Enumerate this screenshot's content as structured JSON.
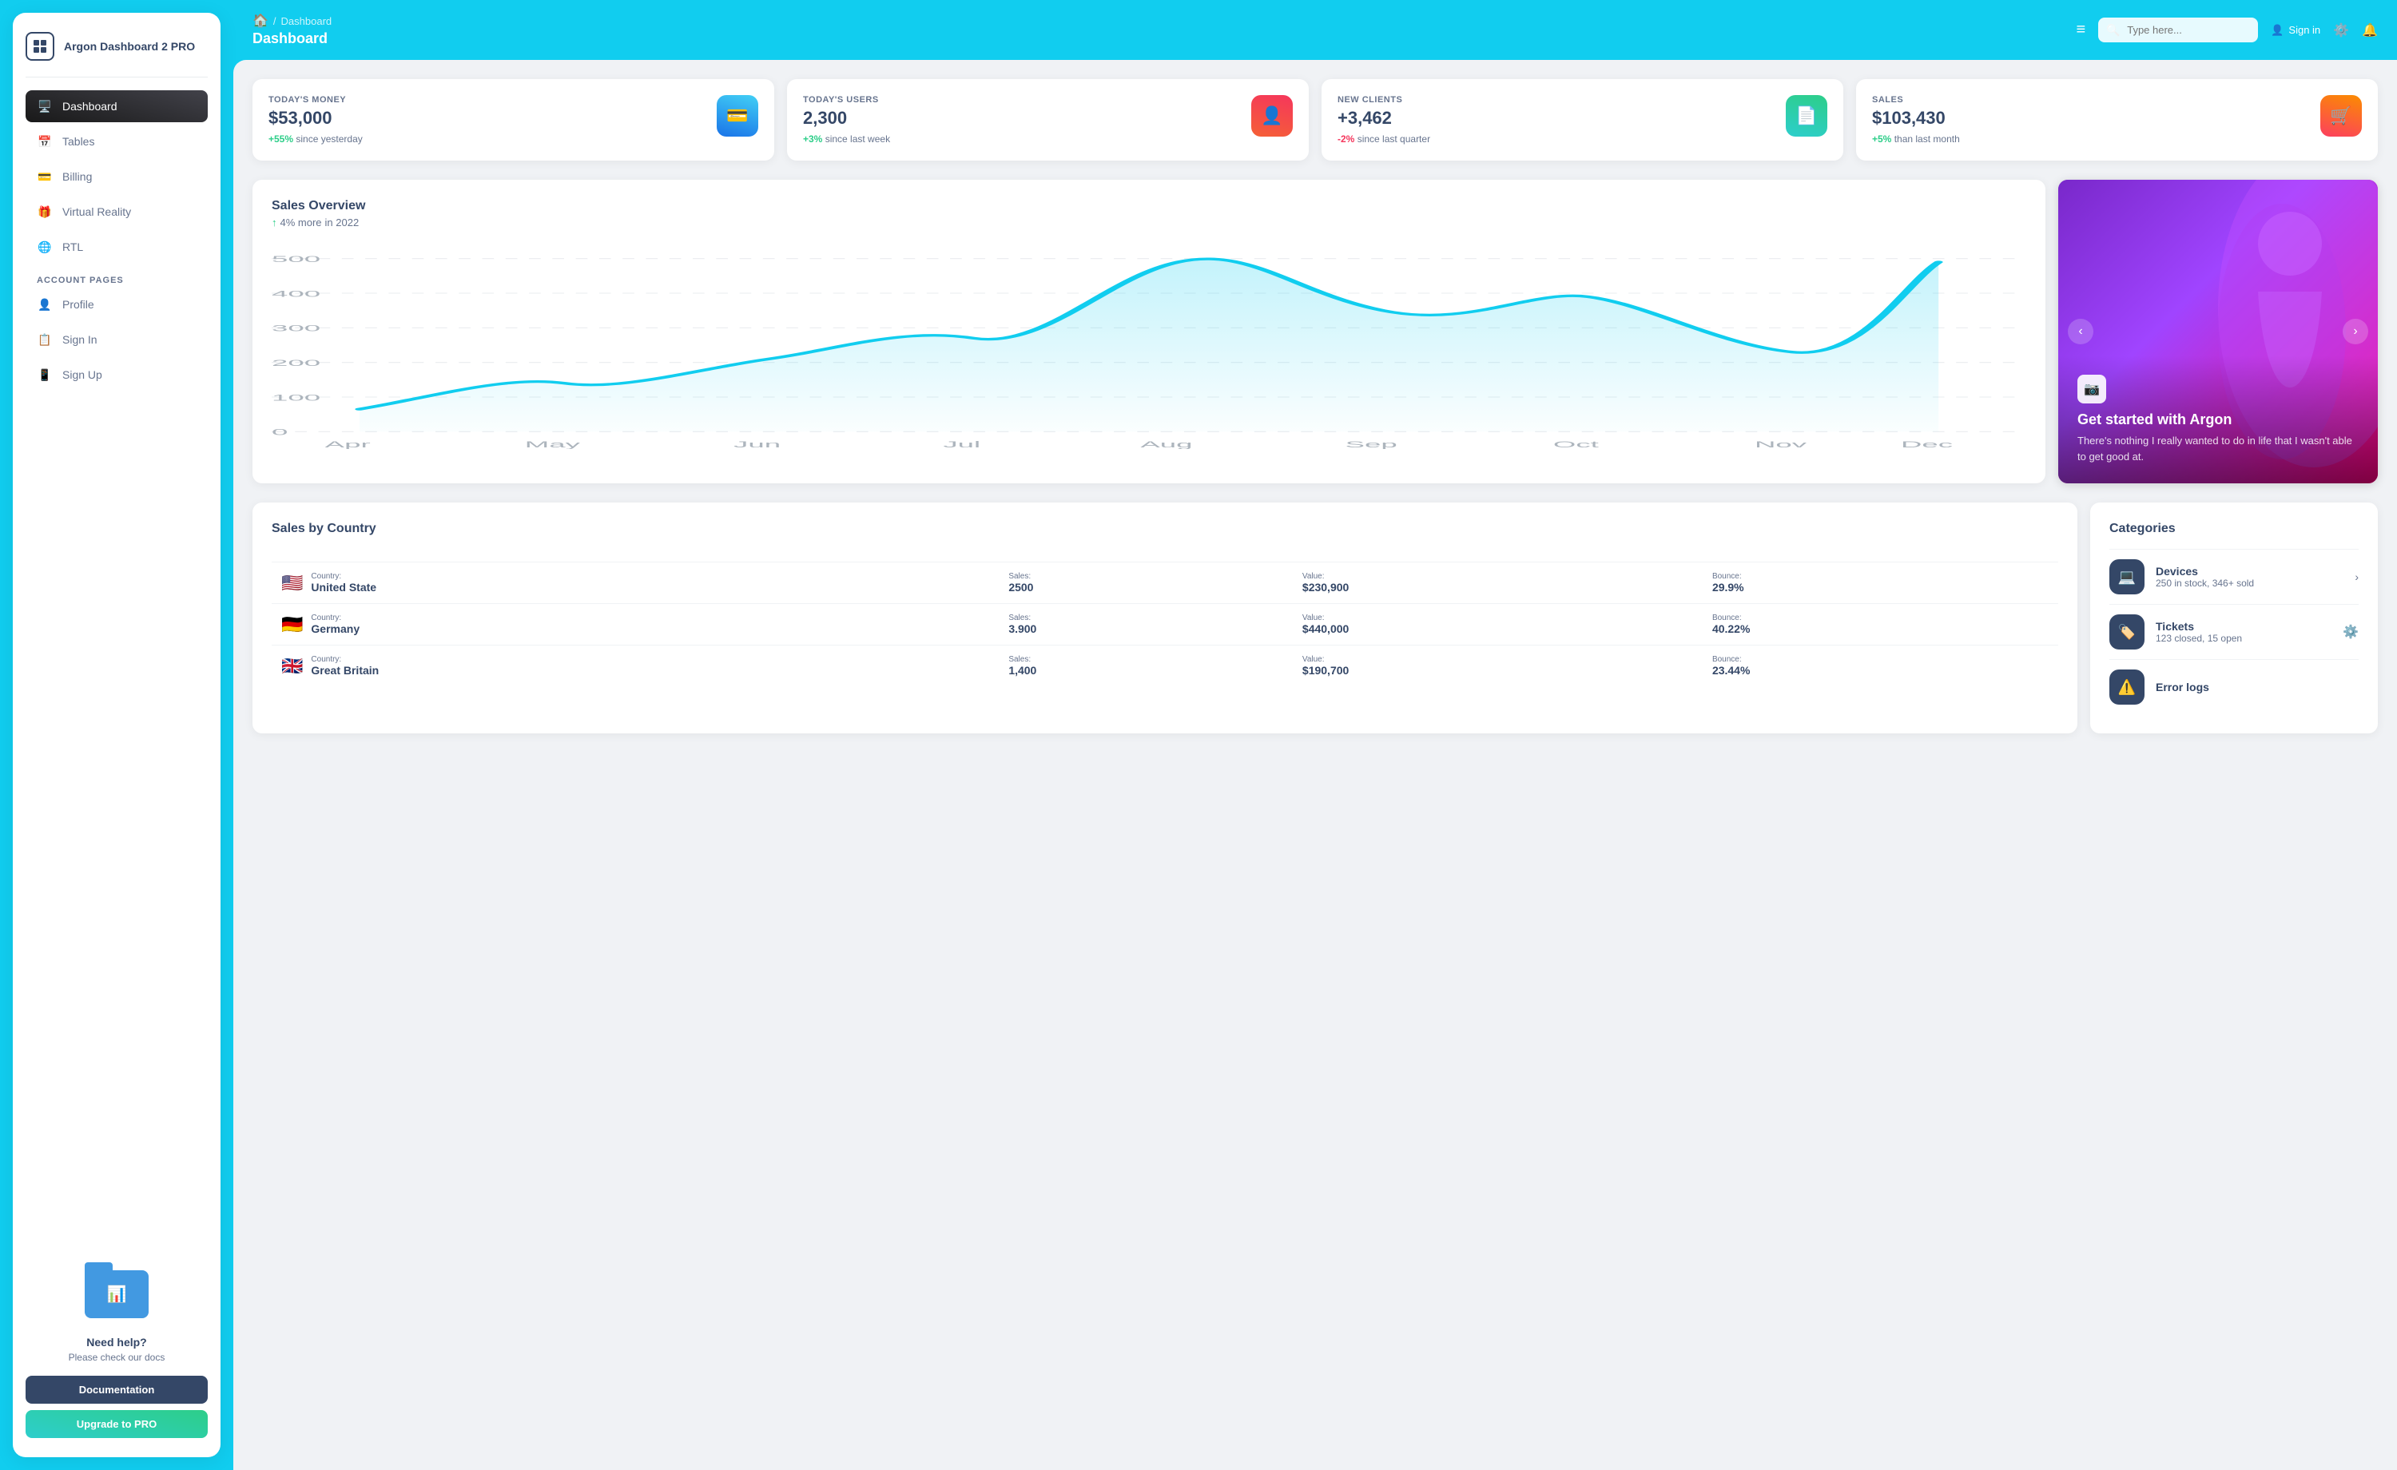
{
  "sidebar": {
    "logo_text": "Argon Dashboard 2 PRO",
    "nav_items": [
      {
        "id": "dashboard",
        "label": "Dashboard",
        "active": true,
        "icon": "🖥️"
      },
      {
        "id": "tables",
        "label": "Tables",
        "active": false,
        "icon": "📅"
      },
      {
        "id": "billing",
        "label": "Billing",
        "active": false,
        "icon": "💳"
      },
      {
        "id": "virtual-reality",
        "label": "Virtual Reality",
        "active": false,
        "icon": "🎁"
      },
      {
        "id": "rtl",
        "label": "RTL",
        "active": false,
        "icon": "🌐"
      }
    ],
    "account_section_label": "ACCOUNT PAGES",
    "account_items": [
      {
        "id": "profile",
        "label": "Profile",
        "icon": "👤"
      },
      {
        "id": "sign-in",
        "label": "Sign In",
        "icon": "📋"
      },
      {
        "id": "sign-up",
        "label": "Sign Up",
        "icon": "📱"
      }
    ],
    "help": {
      "title": "Need help?",
      "subtitle": "Please check our docs",
      "btn_docs": "Documentation",
      "btn_upgrade": "Upgrade to PRO"
    }
  },
  "header": {
    "breadcrumb_home": "🏠",
    "breadcrumb_sep": "/",
    "breadcrumb_page": "Dashboard",
    "title": "Dashboard",
    "menu_icon": "≡",
    "search_placeholder": "Type here...",
    "sign_in": "Sign in"
  },
  "stat_cards": [
    {
      "label": "TODAY'S MONEY",
      "value": "$53,000",
      "change_highlight": "+55%",
      "change_suffix": "since yesterday",
      "change_type": "pos",
      "icon": "💳",
      "icon_class": "stat-icon-blue"
    },
    {
      "label": "TODAY'S USERS",
      "value": "2,300",
      "change_highlight": "+3%",
      "change_suffix": "since last week",
      "change_type": "pos",
      "icon": "👤",
      "icon_class": "stat-icon-red"
    },
    {
      "label": "NEW CLIENTS",
      "value": "+3,462",
      "change_highlight": "-2%",
      "change_suffix": "since last quarter",
      "change_type": "neg",
      "icon": "📄",
      "icon_class": "stat-icon-green"
    },
    {
      "label": "SALES",
      "value": "$103,430",
      "change_highlight": "+5%",
      "change_suffix": "than last month",
      "change_type": "pos",
      "icon": "🛒",
      "icon_class": "stat-icon-orange"
    }
  ],
  "chart": {
    "title": "Sales Overview",
    "subtitle_highlight": "4% more",
    "subtitle_rest": "in 2022",
    "x_labels": [
      "Apr",
      "May",
      "Jun",
      "Jul",
      "Aug",
      "Sep",
      "Oct",
      "Nov",
      "Dec"
    ],
    "y_labels": [
      "500",
      "400",
      "300",
      "200",
      "100",
      "0"
    ],
    "data_points": [
      65,
      140,
      210,
      270,
      490,
      350,
      390,
      230,
      490
    ]
  },
  "promo": {
    "title": "Get started with Argon",
    "description": "There's nothing I really wanted to do in life that I wasn't able to get good at.",
    "icon": "📷"
  },
  "sales_by_country": {
    "title": "Sales by Country",
    "col_country": "Country:",
    "col_sales": "Sales:",
    "col_value": "Value:",
    "col_bounce": "Bounce:",
    "rows": [
      {
        "flag": "🇺🇸",
        "country": "United State",
        "sales": "2500",
        "value": "$230,900",
        "bounce": "29.9%"
      },
      {
        "flag": "🇩🇪",
        "country": "Germany",
        "sales": "3.900",
        "value": "$440,000",
        "bounce": "40.22%"
      },
      {
        "flag": "🇬🇧",
        "country": "Great Britain",
        "sales": "1,400",
        "value": "$190,700",
        "bounce": "23.44%"
      }
    ]
  },
  "categories": {
    "title": "Categories",
    "items": [
      {
        "id": "devices",
        "name": "Devices",
        "sub": "250 in stock, 346+ sold",
        "icon": "💻"
      },
      {
        "id": "tickets",
        "name": "Tickets",
        "sub": "123 closed, 15 open",
        "icon": "🏷️"
      },
      {
        "id": "error-logs",
        "name": "Error logs",
        "sub": "",
        "icon": "⚠️"
      }
    ]
  }
}
